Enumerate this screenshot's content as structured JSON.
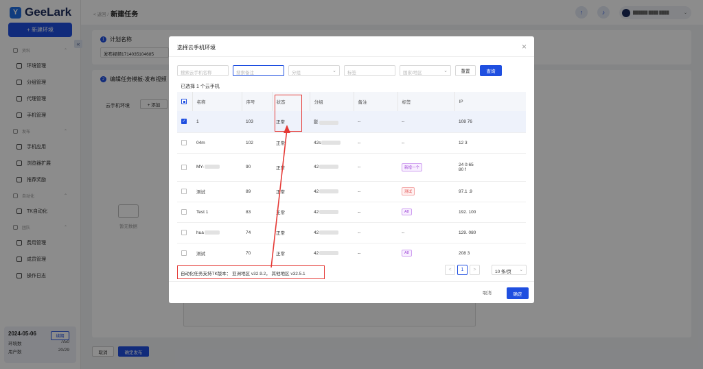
{
  "app": {
    "logo_text": "GeeLark",
    "new_env_label": "+ 新建环境"
  },
  "sidebar": {
    "groups": [
      {
        "label": "资料",
        "items": [
          "环境管理",
          "分组管理",
          "代理管理",
          "手机管理"
        ]
      },
      {
        "label": "发布",
        "items": [
          "手机应用",
          "浏览器扩展",
          "推荐奖励"
        ]
      },
      {
        "label": "自动化",
        "items": [
          "TK自动化"
        ]
      },
      {
        "label": "团队",
        "items": [
          "费用管理",
          "成员管理",
          "操作日志"
        ]
      }
    ],
    "card": {
      "date": "2024-05-06",
      "renew_label": "续期",
      "env_label": "环境数",
      "env_value": "7/50",
      "user_label": "用户数",
      "user_value": "20/29"
    }
  },
  "topbar": {
    "back_label": "< 返回 /",
    "title": "新建任务",
    "user_name": "██████ ████ ████"
  },
  "form": {
    "plan_step_num": "1",
    "plan_step_label": "计划名称",
    "plan_name_value": "发布视频1714035104685",
    "template_step_num": "2",
    "template_step_label": "编辑任务模板-发布视频",
    "cloud_label": "云手机环境",
    "add_label": "+ 添加",
    "empty_label": "暂无数据",
    "cancel_label": "取消",
    "confirm_label": "确定发布"
  },
  "modal": {
    "title": "选择云手机环境",
    "close_icon": "close-icon",
    "filters": {
      "name_placeholder": "搜索云手机名称",
      "note_placeholder": "搜索备注",
      "group_placeholder": "分组",
      "tag_placeholder": "标签",
      "region_placeholder": "国家/地区",
      "reset_label": "重置",
      "query_label": "查询"
    },
    "selected_info": "已选择 1 个云手机",
    "columns": [
      "名称",
      "序号",
      "状态",
      "分组",
      "备注",
      "标签",
      "IP"
    ],
    "rows": [
      {
        "name": "1",
        "seq": "103",
        "status": "正常",
        "group": "影",
        "note": "--",
        "tag": "--",
        "ip": "108 76",
        "checked": true
      },
      {
        "name": "04m",
        "seq": "102",
        "status": "正常",
        "group": "42s",
        "note": "--",
        "tag": "--",
        "ip": "12 3",
        "checked": false
      },
      {
        "name": "MY-",
        "seq": "90",
        "status": "正常",
        "group": "42",
        "note": "--",
        "tag": "新增一个",
        "ip": "24 0:65",
        "ip2": "80 f",
        "checked": false
      },
      {
        "name": "测试",
        "seq": "89",
        "status": "正常",
        "group": "42",
        "note": "--",
        "tag": "测试",
        "ip": "97.1 .9",
        "checked": false
      },
      {
        "name": "Test 1",
        "seq": "83",
        "status": "正常",
        "group": "42",
        "note": "--",
        "tag": "A8",
        "ip": "192. 100",
        "checked": false
      },
      {
        "name": "hua",
        "seq": "74",
        "status": "正常",
        "group": "42",
        "note": "--",
        "tag": "--",
        "ip": "129. 080",
        "checked": false
      },
      {
        "name": "测试",
        "seq": "70",
        "status": "正常",
        "group": "42",
        "note": "--",
        "tag": "A8",
        "ip": "208 3",
        "checked": false
      }
    ],
    "tk_version": "自动化任务支持TK版本： 亚洲地区 v32.9.2， 其他地区 v32.5.1",
    "pager": {
      "prev": "<",
      "current": "1",
      "next": ">",
      "page_size": "10 条/页"
    },
    "cancel_label": "取消",
    "ok_label": "确定"
  },
  "colors": {
    "accent": "#1f4fe0",
    "highlight": "#e53935"
  }
}
